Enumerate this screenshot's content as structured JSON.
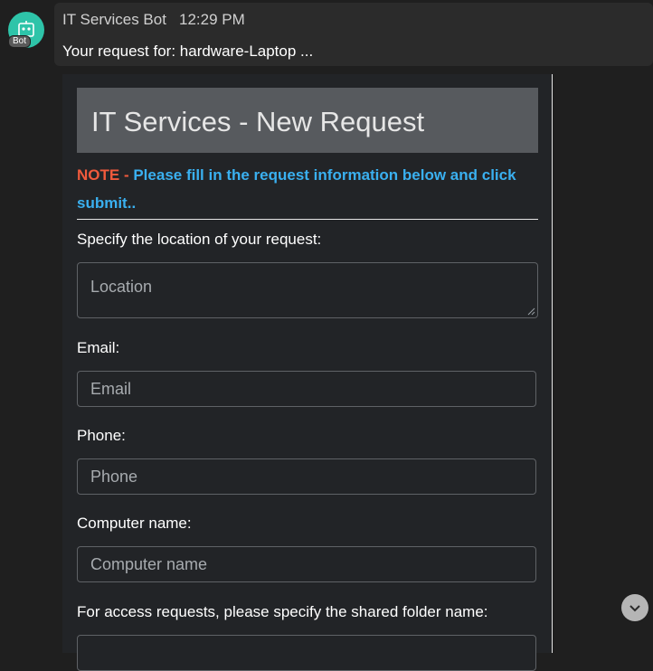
{
  "message": {
    "sender": "IT Services Bot",
    "time": "12:29 PM",
    "text": "Your request for: hardware-Laptop ...",
    "avatar_badge": "Bot",
    "avatar_color": "#2ec4a9"
  },
  "card": {
    "title": "IT Services - New Request",
    "note_label": "NOTE - ",
    "note_text": "Please fill in the request information below and click submit..",
    "note_label_color": "#f05a3c",
    "note_text_color": "#3ab0f0",
    "fields": {
      "location": {
        "label": "Specify the location of your request:",
        "placeholder": "Location",
        "value": ""
      },
      "email": {
        "label": "Email:",
        "placeholder": "Email",
        "value": ""
      },
      "phone": {
        "label": "Phone:",
        "placeholder": "Phone",
        "value": ""
      },
      "computer": {
        "label": "Computer name:",
        "placeholder": "Computer name",
        "value": ""
      },
      "shared_folder": {
        "label": "For access requests, please specify the shared folder name:",
        "placeholder": "",
        "value": ""
      }
    }
  },
  "icons": {
    "avatar": "bot-icon",
    "scroll": "chevron-down-icon"
  }
}
